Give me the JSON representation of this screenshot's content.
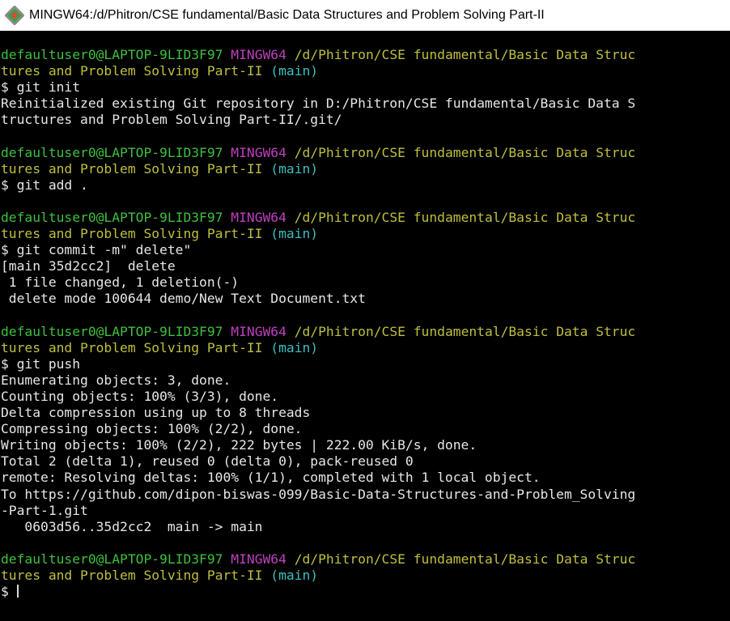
{
  "window": {
    "title": "MINGW64:/d/Phitron/CSE fundamental/Basic Data Structures and Problem Solving Part-II",
    "icon": "git-bash-icon",
    "colors": {
      "background": "#000000",
      "user_host": "#3fbf3f",
      "shell_name": "#bf3fbf",
      "path": "#bfbf3f",
      "branch": "#3fbfbf",
      "output": "#d8d8d8"
    }
  },
  "prompt": {
    "user_host": "defaultuser0@LAPTOP-9LID3F97",
    "shell": "MINGW64",
    "path_line1": "/d/Phitron/CSE fundamental/Basic Data Struc",
    "path_line2": "tures and Problem Solving Part-II",
    "branch": "(main)",
    "symbol": "$"
  },
  "blocks": [
    {
      "command": " git init",
      "output": [
        "Reinitialized existing Git repository in D:/Phitron/CSE fundamental/Basic Data S",
        "tructures and Problem Solving Part-II/.git/"
      ]
    },
    {
      "command": " git add .",
      "output": []
    },
    {
      "command": " git commit -m\" delete\"",
      "output": [
        "[main 35d2cc2]  delete",
        " 1 file changed, 1 deletion(-)",
        " delete mode 100644 demo/New Text Document.txt"
      ]
    },
    {
      "command": " git push",
      "output": [
        "Enumerating objects: 3, done.",
        "Counting objects: 100% (3/3), done.",
        "Delta compression using up to 8 threads",
        "Compressing objects: 100% (2/2), done.",
        "Writing objects: 100% (2/2), 222 bytes | 222.00 KiB/s, done.",
        "Total 2 (delta 1), reused 0 (delta 0), pack-reused 0",
        "remote: Resolving deltas: 100% (1/1), completed with 1 local object.",
        "To https://github.com/dipon-biswas-099/Basic-Data-Structures-and-Problem_Solving",
        "-Part-1.git",
        "   0603d56..35d2cc2  main -> main"
      ]
    }
  ]
}
